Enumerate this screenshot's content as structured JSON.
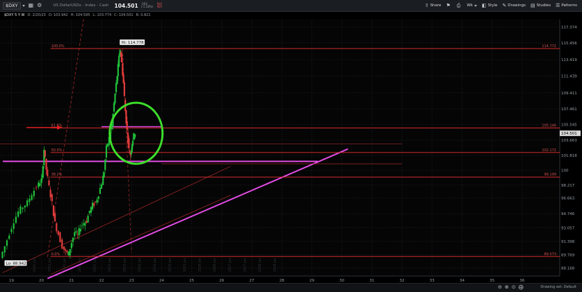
{
  "header": {
    "symbol": "$DXY",
    "description": "US DollarUSDx - Index - Cash",
    "last": "104.501",
    "change_top": "-263",
    "change_bot": "(-1.18%)",
    "bid_ask_top": "N/A",
    "bid_ask_bot": "N/A"
  },
  "subheader": {
    "symbol_period": "$DXY 5 Y W",
    "date": "D: 2/20/23",
    "open": "O: 103.942",
    "high": "H: 104.595",
    "low": "L: 103.774",
    "close": "C: 104.501",
    "range": "R: 0.821"
  },
  "toolbar": {
    "share": "Share",
    "wk": "Wk",
    "style": "Style",
    "drawings": "Drawings",
    "studies": "Studies",
    "patterns": "Patterns"
  },
  "footer": {
    "drawing_set": "Drawing set: Default"
  },
  "colors": {
    "up": "#1fbf3a",
    "down": "#e23b3b",
    "fib": "#d22b2b",
    "magenta": "#e44ce6",
    "circle": "#3dde2b",
    "arrow": "#e02020"
  },
  "chart_data": {
    "type": "candlestick",
    "x_ticks": [
      "19",
      "20",
      "21",
      "22",
      "23",
      "24",
      "25",
      "26",
      "27",
      "28",
      "29",
      "30",
      "31",
      "32",
      "33",
      "34",
      "35",
      "36"
    ],
    "future_ticks": [
      "2020 Jun",
      "2021 Jan",
      "2021 Jun",
      "2022 Jan",
      "2022 Jun",
      "2023 Jan",
      "2023 Jun",
      "2024 Jan",
      "2024 Jun",
      "2025 Jan",
      "2025 Jun",
      "2026 Jan",
      "2026 Jun",
      "2027 Jan",
      "2027 Jun",
      "2028 Jan",
      "2028 Jun"
    ],
    "y_ticks": [
      117.374,
      115.456,
      113.419,
      111.439,
      109.411,
      107.461,
      105.545,
      103.663,
      101.818,
      100,
      98.217,
      96.663,
      94.746,
      93.057,
      91.398,
      89.769,
      88.168
    ],
    "ylim": [
      87.2,
      118.3
    ],
    "last_price": 104.501,
    "high_label": "Hi: 114.778",
    "low_label": "Lo: 88.942",
    "fib_levels": [
      {
        "pct": "100.0%",
        "value": 114.772,
        "value_label": "114.772"
      },
      {
        "pct": "61.8%",
        "value": 105.146,
        "value_label": "105.146"
      },
      {
        "pct": "50.0%",
        "value": 102.172,
        "value_label": "102.172"
      },
      {
        "pct": "38.2%",
        "value": 99.199,
        "value_label": "99.199"
      },
      {
        "pct": "0.0%",
        "value": 89.573,
        "value_label": "89.573"
      }
    ],
    "price_path": [
      [
        18.7,
        89.4
      ],
      [
        18.85,
        90.8
      ],
      [
        19.0,
        92.4
      ],
      [
        19.15,
        93.9
      ],
      [
        19.3,
        95.0
      ],
      [
        19.45,
        95.6
      ],
      [
        19.6,
        96.1
      ],
      [
        19.75,
        97.2
      ],
      [
        19.9,
        98.0
      ],
      [
        20.0,
        98.6
      ],
      [
        20.05,
        99.1
      ],
      [
        20.12,
        102.6
      ],
      [
        20.2,
        100.1
      ],
      [
        20.3,
        98.0
      ],
      [
        20.4,
        96.0
      ],
      [
        20.5,
        93.6
      ],
      [
        20.62,
        92.3
      ],
      [
        20.75,
        90.8
      ],
      [
        20.85,
        90.1
      ],
      [
        20.95,
        89.9
      ],
      [
        21.05,
        91.3
      ],
      [
        21.15,
        92.5
      ],
      [
        21.25,
        92.1
      ],
      [
        21.35,
        93.2
      ],
      [
        21.45,
        93.6
      ],
      [
        21.55,
        93.9
      ],
      [
        21.65,
        95.1
      ],
      [
        21.75,
        95.8
      ],
      [
        21.85,
        96.1
      ],
      [
        21.95,
        97.2
      ],
      [
        22.05,
        98.5
      ],
      [
        22.12,
        99.9
      ],
      [
        22.2,
        102.7
      ],
      [
        22.3,
        103.9
      ],
      [
        22.38,
        105.5
      ],
      [
        22.45,
        108.1
      ],
      [
        22.52,
        110.4
      ],
      [
        22.58,
        112.6
      ],
      [
        22.65,
        114.7
      ],
      [
        22.7,
        113.0
      ],
      [
        22.76,
        110.6
      ],
      [
        22.82,
        107.2
      ],
      [
        22.88,
        104.8
      ],
      [
        22.94,
        102.5
      ],
      [
        22.99,
        101.9
      ],
      [
        23.04,
        103.3
      ],
      [
        23.1,
        104.2
      ],
      [
        23.13,
        104.5
      ]
    ]
  }
}
